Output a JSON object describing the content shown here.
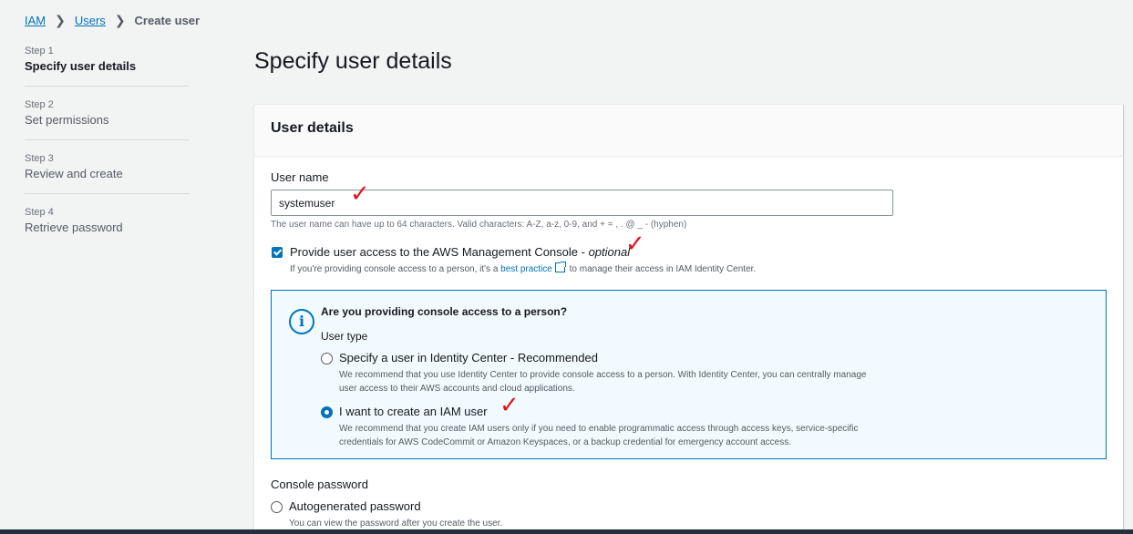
{
  "breadcrumb": {
    "item1": "IAM",
    "item2": "Users",
    "current": "Create user"
  },
  "steps": [
    {
      "num": "Step 1",
      "name": "Specify user details"
    },
    {
      "num": "Step 2",
      "name": "Set permissions"
    },
    {
      "num": "Step 3",
      "name": "Review and create"
    },
    {
      "num": "Step 4",
      "name": "Retrieve password"
    }
  ],
  "page_title": "Specify user details",
  "panel": {
    "title": "User details",
    "username_label": "User name",
    "username_value": "systemuser",
    "username_hint": "The user name can have up to 64 characters. Valid characters: A-Z, a-z, 0-9, and + = , . @ _ - (hyphen)",
    "console_access_label": "Provide user access to the AWS Management Console - ",
    "console_access_optional": "optional",
    "console_access_desc_pre": "If you're providing console access to a person, it's a ",
    "console_access_link": "best practice",
    "console_access_desc_post": " to manage their access in IAM Identity Center.",
    "info": {
      "title": "Are you providing console access to a person?",
      "subtitle": "User type",
      "option1_label": "Specify a user in Identity Center - Recommended",
      "option1_desc": "We recommend that you use Identity Center to provide console access to a person. With Identity Center, you can centrally manage user access to their AWS accounts and cloud applications.",
      "option2_label": "I want to create an IAM user",
      "option2_desc": "We recommend that you create IAM users only if you need to enable programmatic access through access keys, service-specific credentials for AWS CodeCommit or Amazon Keyspaces, or a backup credential for emergency account access."
    },
    "console_password_label": "Console password",
    "autogen_label": "Autogenerated password",
    "autogen_desc": "You can view the password after you create the user."
  },
  "annotations": {
    "check_mark": "✓"
  },
  "colors": {
    "accent": "#0073bb",
    "annotation": "#e0141e"
  }
}
